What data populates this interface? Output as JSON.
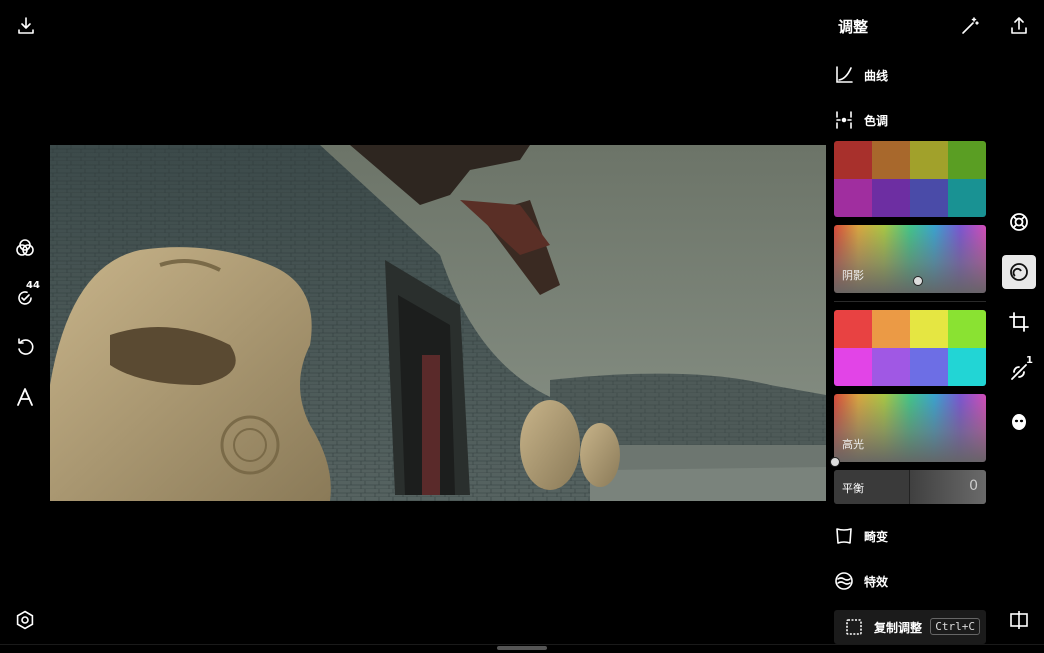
{
  "panel": {
    "title": "调整",
    "curves_label": "曲线",
    "tone_label": "色调",
    "shadows_label": "阴影",
    "highlights_label": "高光",
    "balance_label": "平衡",
    "balance_value": "0",
    "distortion_label": "畸变",
    "effects_label": "特效",
    "copy_label": "复制调整",
    "copy_shortcut": "Ctrl+C"
  },
  "shadow_swatches": [
    "#a8302c",
    "#a8682c",
    "#a1a12b",
    "#5a9e23",
    "#a02e9f",
    "#6d2ea2",
    "#4a4ba8",
    "#199293"
  ],
  "highlight_swatches": [
    "#e84242",
    "#eb9a45",
    "#e5e642",
    "#8ae232",
    "#e244e7",
    "#a058e4",
    "#6d6ee5",
    "#22d5d5"
  ],
  "left_toolbar": {
    "edit_badge": "44"
  },
  "right_toolbar": {
    "retouch_badge": "1"
  },
  "accent": "#e8e8e8"
}
